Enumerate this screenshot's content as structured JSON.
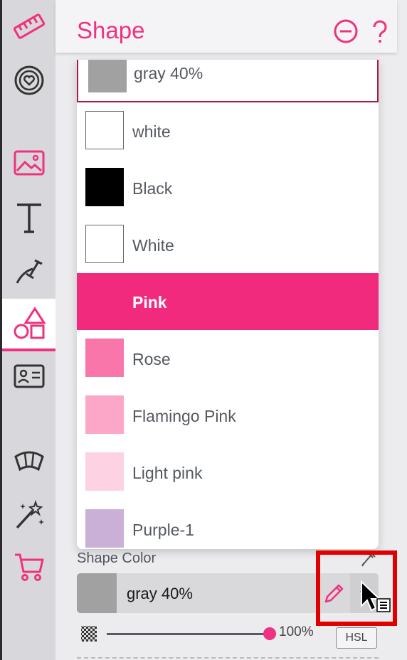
{
  "colors": {
    "accent": "#f0317f",
    "highlight": "#e00000"
  },
  "sidebar": {
    "items": [
      {
        "name": "ruler-icon"
      },
      {
        "name": "heart-badge-icon"
      },
      {
        "name": "image-icon"
      },
      {
        "name": "text-icon"
      },
      {
        "name": "line-tool-icon"
      },
      {
        "name": "shapes-icon",
        "active": true
      },
      {
        "name": "id-card-icon"
      },
      {
        "name": "arc-icon"
      },
      {
        "name": "magic-wand-icon"
      },
      {
        "name": "cart-icon"
      }
    ]
  },
  "header": {
    "title": "Shape"
  },
  "dropdown": {
    "items": [
      {
        "label": "gray 40%",
        "color": "#a1a1a1"
      },
      {
        "label": "white",
        "color": "#ffffff"
      },
      {
        "label": "Black",
        "color": "#000000"
      },
      {
        "label": "White",
        "color": "#ffffff"
      },
      {
        "label": "Pink",
        "color": "#f22a7e",
        "selected": true
      },
      {
        "label": "Rose",
        "color": "#f876a9"
      },
      {
        "label": "Flamingo Pink",
        "color": "#fca7c8"
      },
      {
        "label": "Light pink",
        "color": "#fdd2e3"
      },
      {
        "label": "Purple-1",
        "color": "#cab0d6"
      }
    ]
  },
  "shape_color": {
    "label": "Shape Color",
    "value": "gray 40%",
    "swatch_color": "#a1a1a1",
    "opacity": "100%",
    "opacity_value": 1.0,
    "mode_button": "HSL"
  }
}
